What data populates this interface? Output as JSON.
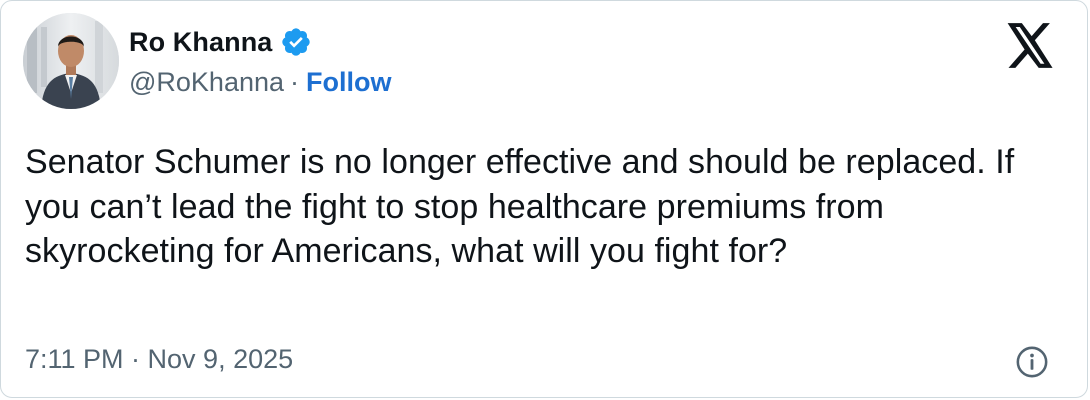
{
  "author": {
    "display_name": "Ro Khanna",
    "handle": "@RoKhanna",
    "separator": "·",
    "follow_label": "Follow",
    "verified_icon": "verified-badge-icon"
  },
  "tweet": {
    "text": "Senator Schumer is no longer effective and should be replaced. If you can’t lead the fight to stop healthcare premiums from skyrocketing for Americans, what will you fight for?",
    "timestamp": "7:11 PM · Nov 9, 2025"
  },
  "icons": {
    "brand": "x-logo-icon",
    "info": "info-icon"
  },
  "colors": {
    "text_primary": "#0f1419",
    "text_secondary": "#536471",
    "follow_link": "#1d6fd1",
    "verified_badge": "#1d9bf0"
  }
}
